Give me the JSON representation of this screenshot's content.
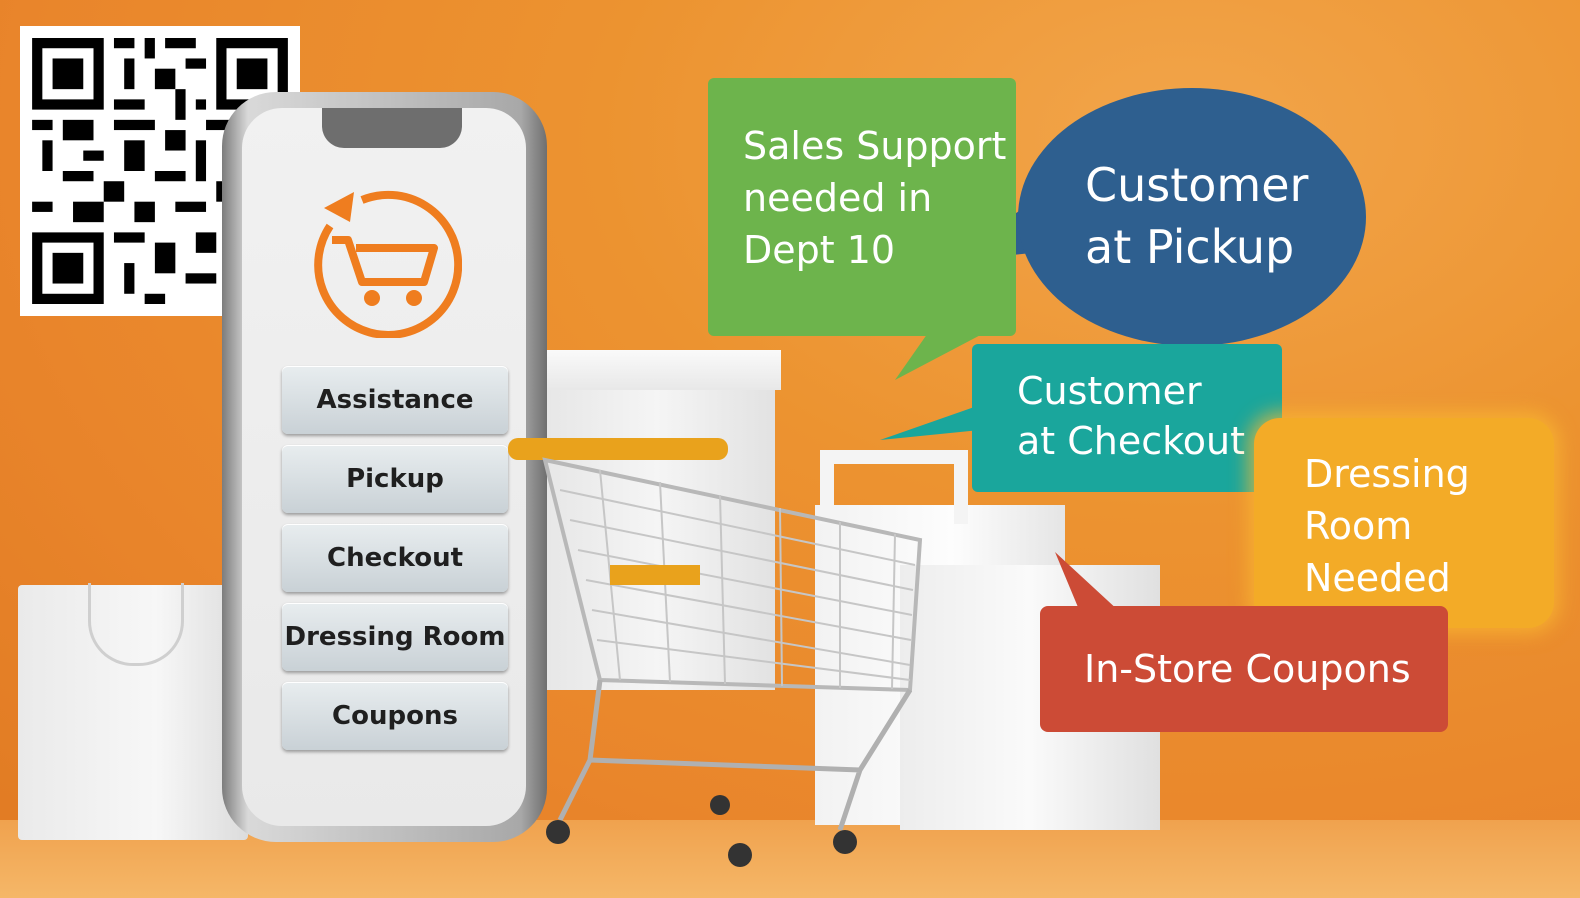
{
  "app": {
    "menu": [
      {
        "label": "Assistance"
      },
      {
        "label": "Pickup"
      },
      {
        "label": "Checkout"
      },
      {
        "label": "Dressing Room"
      },
      {
        "label": "Coupons"
      }
    ],
    "logo_icon": "shopping-cart-refresh-icon"
  },
  "notifications": {
    "sales_support": "Sales Support\nneeded in\nDept 10",
    "customer_pickup": "Customer\nat Pickup",
    "customer_checkout": "Customer\nat Checkout",
    "dressing_room": "Dressing\nRoom\nNeeded",
    "coupons": "In-Store Coupons"
  },
  "colors": {
    "background": "#e9852b",
    "accent": "#ef7d1f",
    "green": "#6db44c",
    "blue": "#2e5f8f",
    "teal": "#1aa69c",
    "yellow": "#f3ab27",
    "red": "#cc4b36"
  },
  "qr_icon": "qr-code-icon"
}
